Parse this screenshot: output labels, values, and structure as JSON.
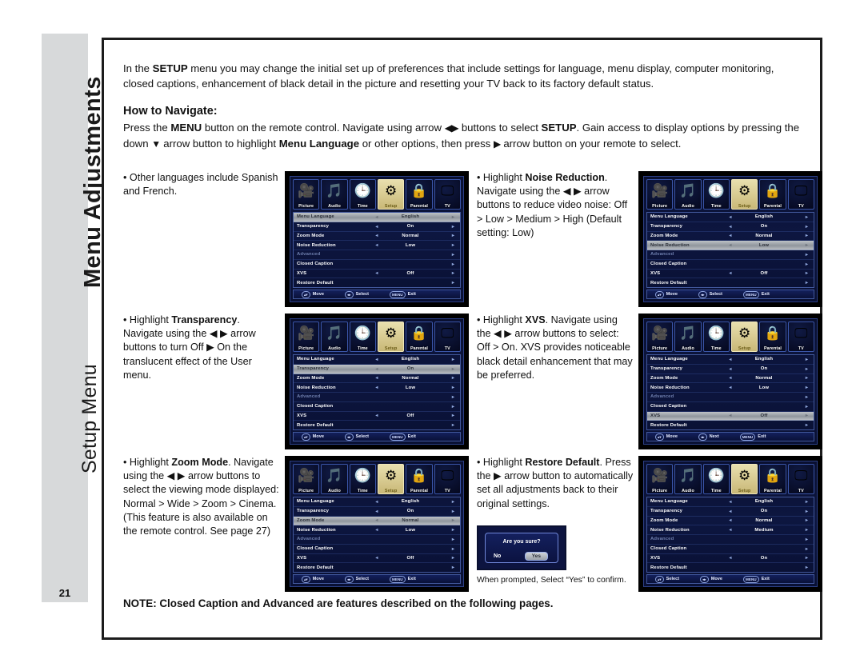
{
  "sidebar": {
    "title": "Menu Adjustments",
    "subtitle": "Setup Menu",
    "page_number": "21"
  },
  "intro": {
    "part1": "In the ",
    "setup": "SETUP",
    "part2": " menu you may change the initial set up of preferences that include settings for language, menu display, computer monitoring, closed captions, enhancement of black detail in the picture and resetting your TV back to its factory default status."
  },
  "navigate": {
    "heading": "How to Navigate:",
    "t1": "Press the ",
    "menu": "MENU",
    "t2": " button on the remote control. Navigate using arrow ",
    "arrows": "◀▶",
    "t3": " buttons to select ",
    "setup": "SETUP",
    "t4": ". Gain access to display options by pressing the down ",
    "down": "▼",
    "t5": " arrow button to highlight ",
    "menu_language": "Menu Language",
    "t6": " or other options, then press ",
    "right": "▶",
    "t7": " arrow button on your remote to select."
  },
  "osd_icons": [
    {
      "label": "Picture",
      "icon": "camcorder-icon",
      "glyph": "🎥"
    },
    {
      "label": "Audio",
      "icon": "audio-icon",
      "glyph": "🎵"
    },
    {
      "label": "Time",
      "icon": "clock-icon",
      "glyph": "🕒"
    },
    {
      "label": "Setup",
      "icon": "gear-icon",
      "glyph": "⚙"
    },
    {
      "label": "Parental",
      "icon": "lock-icon",
      "glyph": "🔒"
    },
    {
      "label": "TV",
      "icon": "tv-icon",
      "glyph": "🖵"
    }
  ],
  "menu_rows": {
    "menu_language": "Menu Language",
    "transparency": "Transparency",
    "zoom_mode": "Zoom Mode",
    "noise_reduction": "Noise Reduction",
    "advanced": "Advanced",
    "closed_caption": "Closed Caption",
    "xvs": "XVS",
    "restore_default": "Restore Default"
  },
  "arrows": {
    "left": "◂",
    "right": "▸"
  },
  "footer_keys": {
    "updown": "▴▾",
    "leftright": "◂▸",
    "menu": "MENU"
  },
  "cells": [
    {
      "id": "cell-other-languages",
      "caption_html": "• Other languages include Spanish and French.",
      "caption_plain": "• Other languages include Spanish and French.",
      "osd": {
        "highlight": "menu_language",
        "values": {
          "menu_language": "English",
          "transparency": "On",
          "zoom_mode": "Normal",
          "noise_reduction": "Low",
          "advanced": "",
          "closed_caption": "",
          "xvs": "Off",
          "restore_default": ""
        },
        "footer": {
          "a": "Move",
          "b": "Select",
          "c": "Exit"
        }
      }
    },
    {
      "id": "cell-noise-reduction",
      "caption_plain": "• Highlight Noise Reduction. Navigate using the ◀ ▶ arrow buttons to reduce video noise: Off > Low > Medium > High (Default setting: Low)",
      "bold_term": "Noise Reduction",
      "osd": {
        "highlight": "noise_reduction",
        "values": {
          "menu_language": "English",
          "transparency": "On",
          "zoom_mode": "Normal",
          "noise_reduction": "Low",
          "advanced": "",
          "closed_caption": "",
          "xvs": "Off",
          "restore_default": ""
        },
        "footer": {
          "a": "Move",
          "b": "Select",
          "c": "Exit"
        }
      }
    },
    {
      "id": "cell-transparency",
      "caption_plain": "• Highlight Transparency. Navigate using the ◀ ▶ arrow buttons to turn Off ▶ On the translucent effect of the User menu.",
      "bold_term": "Transparency",
      "osd": {
        "highlight": "transparency",
        "values": {
          "menu_language": "English",
          "transparency": "On",
          "zoom_mode": "Normal",
          "noise_reduction": "Low",
          "advanced": "",
          "closed_caption": "",
          "xvs": "Off",
          "restore_default": ""
        },
        "footer": {
          "a": "Move",
          "b": "Select",
          "c": "Exit"
        }
      }
    },
    {
      "id": "cell-xvs",
      "caption_plain": "• Highlight XVS. Navigate using the ◀ ▶ arrow buttons to select: Off > On. XVS provides noticeable black detail enhancement that may be preferred.",
      "bold_term": "XVS",
      "osd": {
        "highlight": "xvs",
        "values": {
          "menu_language": "English",
          "transparency": "On",
          "zoom_mode": "Normal",
          "noise_reduction": "Low",
          "advanced": "",
          "closed_caption": "",
          "xvs": "Off",
          "restore_default": ""
        },
        "footer": {
          "a": "Move",
          "b": "Next",
          "c": "Exit"
        }
      }
    },
    {
      "id": "cell-zoom-mode",
      "caption_plain": "• Highlight Zoom Mode. Navigate using the ◀ ▶ arrow buttons to select the viewing mode displayed: Normal > Wide > Zoom > Cinema. (This feature is also available on the remote control. See page 27)",
      "bold_term": "Zoom Mode",
      "osd": {
        "highlight": "zoom_mode",
        "values": {
          "menu_language": "English",
          "transparency": "On",
          "zoom_mode": "Normal",
          "noise_reduction": "Low",
          "advanced": "",
          "closed_caption": "",
          "xvs": "Off",
          "restore_default": ""
        },
        "footer": {
          "a": "Move",
          "b": "Select",
          "c": "Exit"
        }
      }
    },
    {
      "id": "cell-restore-default",
      "caption_plain": "• Highlight Restore Default. Press the ▶ arrow button to automatically set all adjustments back to their original settings.",
      "bold_term": "Restore Default",
      "osd": {
        "highlight": "none",
        "values": {
          "menu_language": "English",
          "transparency": "On",
          "zoom_mode": "Normal",
          "noise_reduction": "Medium",
          "advanced": "",
          "closed_caption": "",
          "xvs": "On",
          "restore_default": ""
        },
        "footer": {
          "a": "Select",
          "b": "Move",
          "c": "Exit"
        }
      }
    }
  ],
  "confirm_dialog": {
    "question": "Are you sure?",
    "no_label": "No",
    "yes_label": "Yes",
    "caption": "When prompted, Select “Yes” to confirm."
  },
  "bottom_note": "NOTE: Closed Caption and Advanced are features described on the following pages."
}
